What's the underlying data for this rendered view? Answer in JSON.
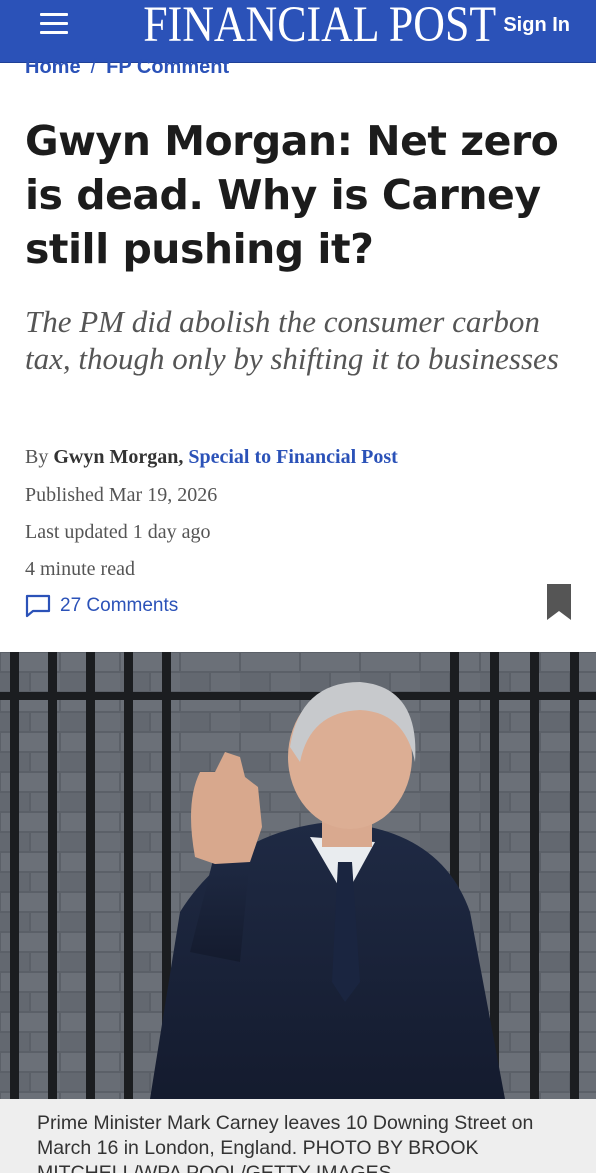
{
  "header": {
    "brand": "FINANCIAL POST",
    "sign_in": "Sign In",
    "menu_icon": "hamburger-menu-icon",
    "background_color": "#2b52b8"
  },
  "breadcrumb": {
    "items": [
      "Home",
      "FP Comment"
    ],
    "separator": "/"
  },
  "article": {
    "headline": "Gwyn Morgan: Net zero is dead. Why is Carney still pushing it?",
    "subheadline": "The PM did abolish the consumer carbon tax, though only by shifting it to businesses",
    "byline_prefix": "By",
    "author": "Gwyn Morgan,",
    "author_org": "Special to Financial Post",
    "published": "Published Mar 19, 2026",
    "last_updated": "Last updated 1 day ago",
    "read_time": "4 minute read",
    "comments": "27 Comments",
    "comments_icon": "comment-bubble-icon",
    "bookmark_icon": "bookmark-icon"
  },
  "photo": {
    "caption": "Prime Minister Mark Carney leaves 10 Downing Street on March 16 in London, England. PHOTO BY BROOK MITCHELL/WPA POOL/GETTY IMAGES"
  }
}
